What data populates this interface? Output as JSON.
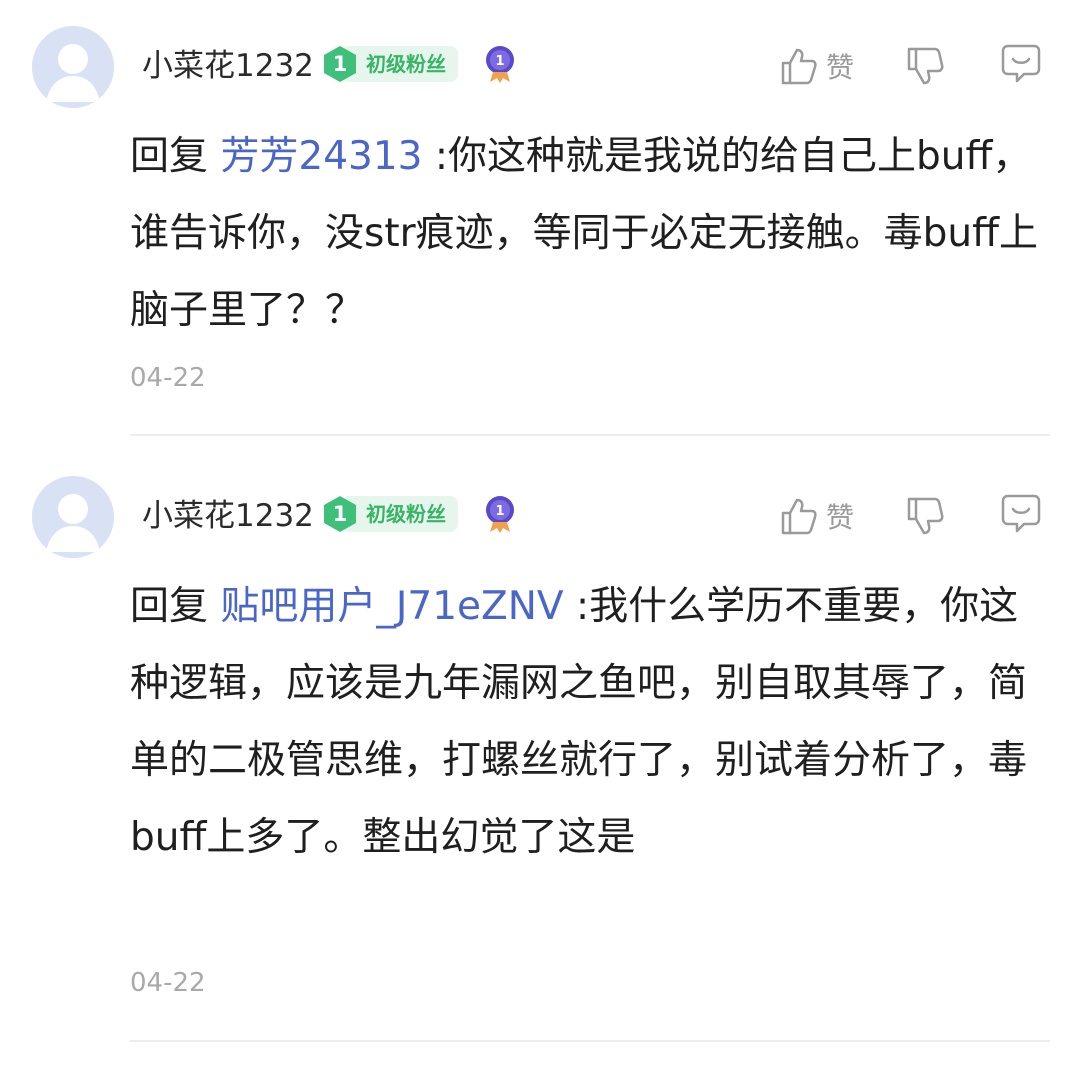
{
  "comments": [
    {
      "username": "小菜花1232",
      "fan_level": "1",
      "fan_label": "初级粉丝",
      "medal_level": "1",
      "like_label": "赞",
      "reply_prefix": "回复",
      "mention": "芳芳24313",
      "text": "  :你这种就是我说的给自己上buff，谁告诉你，没str痕迹，等同于必定无接触。毒buff上脑子里了？？",
      "date": "04-22"
    },
    {
      "username": "小菜花1232",
      "fan_level": "1",
      "fan_label": "初级粉丝",
      "medal_level": "1",
      "like_label": "赞",
      "reply_prefix": "回复",
      "mention": "贴吧用户_J71eZNV",
      "text": "  :我什么学历不重要，你这种逻辑，应该是九年漏网之鱼吧，别自取其辱了，简单的二极管思维，打螺丝就行了，别试着分析了，毒buff上多了。整出幻觉了这是",
      "date": "04-22"
    }
  ],
  "colors": {
    "mention": "#4a66c8",
    "fan_green": "#36b566",
    "fan_bg": "#e6f6ec",
    "icon_gray": "#9a9a9a",
    "date_gray": "#a9a9a9",
    "medal_purple": "#5a49c9"
  },
  "icons": {
    "avatar": "default-avatar-icon",
    "fan_level": "diamond-level-icon",
    "medal": "purple-medal-icon",
    "like": "thumbs-up-icon",
    "dislike": "thumbs-down-icon",
    "reply": "chat-bubble-icon"
  }
}
